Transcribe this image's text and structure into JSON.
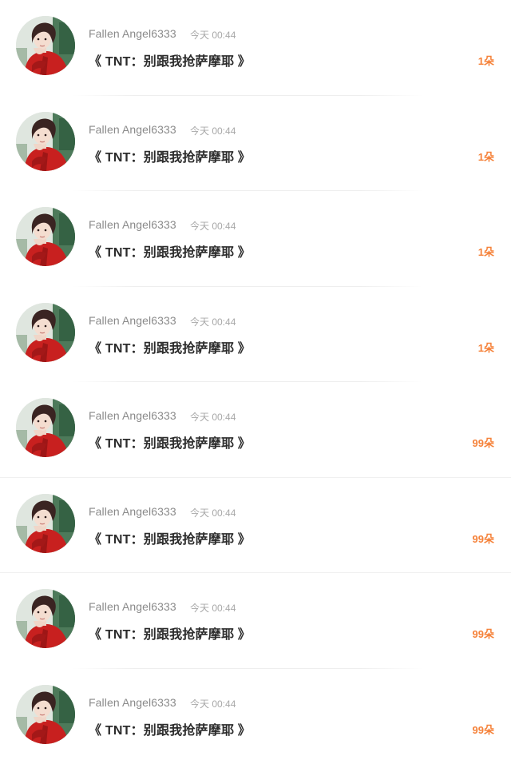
{
  "theme": {
    "gift_color": "#f5823a",
    "username_color": "#8a8a8a",
    "time_color": "#a8a8a8",
    "title_color": "#2b2b2b"
  },
  "comments": [
    {
      "user": "Fallen Angel6333",
      "time": "今天 00:44",
      "title": "《 TNT：别跟我抢萨摩耶 》",
      "gift": "1朵",
      "avatar_icon": "user-avatar-icon"
    },
    {
      "user": "Fallen Angel6333",
      "time": "今天 00:44",
      "title": "《 TNT：别跟我抢萨摩耶 》",
      "gift": "1朵",
      "avatar_icon": "user-avatar-icon"
    },
    {
      "user": "Fallen Angel6333",
      "time": "今天 00:44",
      "title": "《 TNT：别跟我抢萨摩耶 》",
      "gift": "1朵",
      "avatar_icon": "user-avatar-icon"
    },
    {
      "user": "Fallen Angel6333",
      "time": "今天 00:44",
      "title": "《 TNT：别跟我抢萨摩耶 》",
      "gift": "1朵",
      "avatar_icon": "user-avatar-icon"
    },
    {
      "user": "Fallen Angel6333",
      "time": "今天 00:44",
      "title": "《 TNT：别跟我抢萨摩耶 》",
      "gift": "99朵",
      "avatar_icon": "user-avatar-icon"
    },
    {
      "user": "Fallen Angel6333",
      "time": "今天 00:44",
      "title": "《 TNT：别跟我抢萨摩耶 》",
      "gift": "99朵",
      "avatar_icon": "user-avatar-icon"
    },
    {
      "user": "Fallen Angel6333",
      "time": "今天 00:44",
      "title": "《 TNT：别跟我抢萨摩耶 》",
      "gift": "99朵",
      "avatar_icon": "user-avatar-icon"
    },
    {
      "user": "Fallen Angel6333",
      "time": "今天 00:44",
      "title": "《 TNT：别跟我抢萨摩耶 》",
      "gift": "99朵",
      "avatar_icon": "user-avatar-icon"
    }
  ]
}
